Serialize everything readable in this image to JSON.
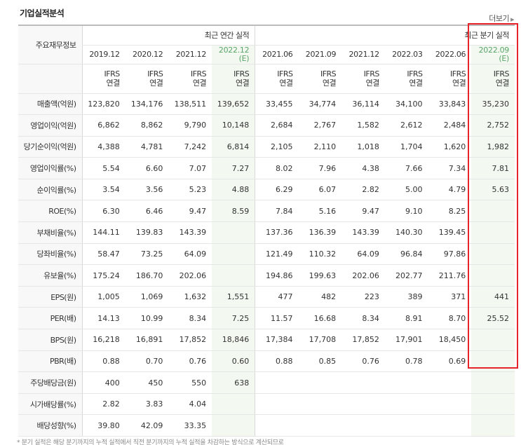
{
  "section": {
    "title": "기업실적분석",
    "more_label": "더보기",
    "more_icon": "chevron-right-icon"
  },
  "table": {
    "row_header_label": "주요재무정보",
    "group_annual": "최근 연간 실적",
    "group_quarter": "최근 분기 실적",
    "periods": [
      {
        "label": "2019.12",
        "est": ""
      },
      {
        "label": "2020.12",
        "est": ""
      },
      {
        "label": "2021.12",
        "est": ""
      },
      {
        "label": "2022.12",
        "est": "(E)"
      },
      {
        "label": "2021.06",
        "est": ""
      },
      {
        "label": "2021.09",
        "est": ""
      },
      {
        "label": "2021.12",
        "est": ""
      },
      {
        "label": "2022.03",
        "est": ""
      },
      {
        "label": "2022.06",
        "est": ""
      },
      {
        "label": "2022.09",
        "est": "(E)"
      }
    ],
    "ifrs_line1": "IFRS",
    "ifrs_line2": "연결",
    "rows": [
      {
        "label": "매출액(억원)",
        "values": [
          "123,820",
          "134,176",
          "138,511",
          "139,652",
          "33,455",
          "34,774",
          "36,114",
          "34,100",
          "33,843",
          "35,230"
        ]
      },
      {
        "label": "영업이익(억원)",
        "values": [
          "6,862",
          "8,862",
          "9,790",
          "10,148",
          "2,684",
          "2,767",
          "1,582",
          "2,612",
          "2,484",
          "2,752"
        ]
      },
      {
        "label": "당기순이익(억원)",
        "values": [
          "4,388",
          "4,781",
          "7,242",
          "6,814",
          "2,105",
          "2,110",
          "1,018",
          "1,704",
          "1,620",
          "1,982"
        ]
      },
      {
        "label": "영업이익률(%)",
        "values": [
          "5.54",
          "6.60",
          "7.07",
          "7.27",
          "8.02",
          "7.96",
          "4.38",
          "7.66",
          "7.34",
          "7.81"
        ]
      },
      {
        "label": "순이익률(%)",
        "values": [
          "3.54",
          "3.56",
          "5.23",
          "4.88",
          "6.29",
          "6.07",
          "2.82",
          "5.00",
          "4.79",
          "5.63"
        ]
      },
      {
        "label": "ROE(%)",
        "values": [
          "6.30",
          "6.46",
          "9.47",
          "8.59",
          "7.84",
          "5.16",
          "9.47",
          "9.10",
          "8.25",
          ""
        ]
      },
      {
        "label": "부채비율(%)",
        "values": [
          "144.11",
          "139.83",
          "143.39",
          "",
          "137.36",
          "136.39",
          "143.39",
          "140.30",
          "139.45",
          ""
        ]
      },
      {
        "label": "당좌비율(%)",
        "values": [
          "58.47",
          "73.25",
          "64.09",
          "",
          "121.49",
          "110.32",
          "64.09",
          "96.84",
          "97.86",
          ""
        ]
      },
      {
        "label": "유보율(%)",
        "values": [
          "175.24",
          "186.70",
          "202.06",
          "",
          "194.86",
          "199.63",
          "202.06",
          "202.77",
          "211.76",
          ""
        ]
      },
      {
        "label": "EPS(원)",
        "values": [
          "1,005",
          "1,069",
          "1,632",
          "1,551",
          "477",
          "482",
          "223",
          "389",
          "371",
          "441"
        ]
      },
      {
        "label": "PER(배)",
        "values": [
          "14.13",
          "10.99",
          "8.34",
          "7.25",
          "11.57",
          "16.68",
          "8.34",
          "8.91",
          "8.70",
          "25.52"
        ]
      },
      {
        "label": "BPS(원)",
        "values": [
          "16,218",
          "16,891",
          "17,852",
          "18,846",
          "17,384",
          "17,708",
          "17,852",
          "17,901",
          "18,450",
          ""
        ]
      },
      {
        "label": "PBR(배)",
        "values": [
          "0.88",
          "0.70",
          "0.76",
          "0.60",
          "0.88",
          "0.85",
          "0.76",
          "0.78",
          "0.69",
          ""
        ]
      },
      {
        "label": "주당배당금(원)",
        "values": [
          "400",
          "450",
          "550",
          "638",
          "",
          "",
          "",
          "",
          "",
          ""
        ]
      },
      {
        "label": "시가배당률(%)",
        "values": [
          "2.82",
          "3.83",
          "4.04",
          "",
          "",
          "",
          "",
          "",
          "",
          ""
        ]
      },
      {
        "label": "배당성향(%)",
        "values": [
          "39.80",
          "42.09",
          "33.35",
          "",
          "",
          "",
          "",
          "",
          "",
          ""
        ]
      }
    ]
  },
  "highlight_color": "#e8242b",
  "footnote": "* 분기 실적은 해당 분기까지의 누적 실적에서 직전 분기까지의 누적 실적을 차감하는 방식으로 계산되므로"
}
